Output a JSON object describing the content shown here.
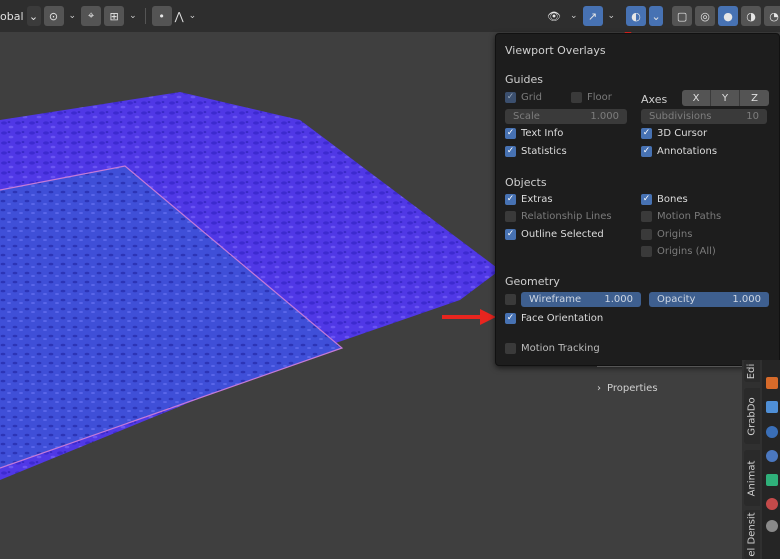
{
  "toolbar": {
    "orientation_label": "obal",
    "chevron": "⌄"
  },
  "popup": {
    "title": "Viewport Overlays",
    "guides": {
      "title": "Guides",
      "grid": "Grid",
      "floor": "Floor",
      "axes": "Axes",
      "axis_x": "X",
      "axis_y": "Y",
      "axis_z": "Z",
      "scale_label": "Scale",
      "scale_value": "1.000",
      "subdivisions_label": "Subdivisions",
      "subdivisions_value": "10",
      "text_info": "Text Info",
      "cursor_3d": "3D Cursor",
      "statistics": "Statistics",
      "annotations": "Annotations"
    },
    "objects": {
      "title": "Objects",
      "extras": "Extras",
      "bones": "Bones",
      "relationship_lines": "Relationship Lines",
      "motion_paths": "Motion Paths",
      "outline_selected": "Outline Selected",
      "origins": "Origins",
      "origins_all": "Origins (All)"
    },
    "geometry": {
      "title": "Geometry",
      "wireframe_label": "Wireframe",
      "wireframe_value": "1.000",
      "opacity_label": "Opacity",
      "opacity_value": "1.000",
      "face_orientation": "Face Orientation"
    },
    "motion_tracking": "Motion Tracking"
  },
  "sidebar": {
    "properties_label": "Properties",
    "tabs": [
      "Edi",
      "GrabDo",
      "Animat",
      "el Densit"
    ]
  },
  "colors": {
    "accent": "#4772b3",
    "mesh": "#4f33e8",
    "arrow": "#e8251f"
  }
}
